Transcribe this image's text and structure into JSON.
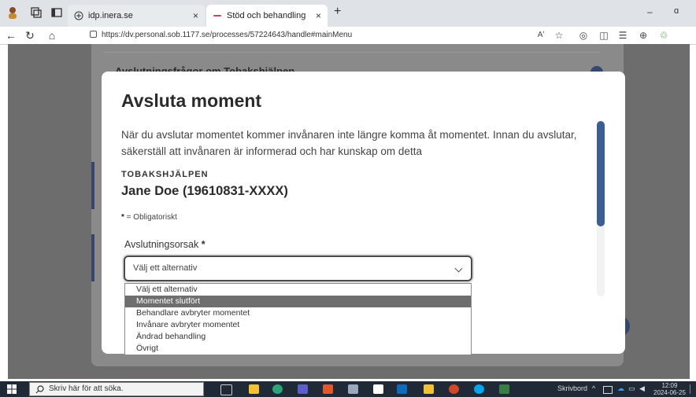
{
  "browser": {
    "tabs": [
      {
        "label": "idp.inera.se",
        "close": "×"
      },
      {
        "label": "Stöd och behandling",
        "close": "×"
      }
    ],
    "new_tab": "+",
    "window_minimize": "–",
    "window_restore": "ɑ",
    "url": "https://dv.personal.sob.1177.se/processes/57224643/handle#mainMenu",
    "reader_label": "Aʹ"
  },
  "page": {
    "background_heading": "Avslutningsfrågor om Tobakshjälpen"
  },
  "modal": {
    "title": "Avsluta moment",
    "description": "När du avslutar momentet kommer invånaren inte längre komma åt momentet. Innan du avslutar, säkerställ att invånaren är informerad och har kunskap om detta",
    "program": "TOBAKSHJÄLPEN",
    "patient": "Jane Doe (19610831-XXXX)",
    "required_star": "*",
    "required_note": " = Obligatoriskt",
    "field_label": "Avslutningsorsak",
    "field_star": "*",
    "select_value": "Välj ett alternativ"
  },
  "dropdown": {
    "options": [
      "Välj ett alternativ",
      "Momentet slutfört",
      "Behandlare avbryter momentet",
      "Invånare avbryter momentet",
      "Ändrad behandling",
      "Övrigt"
    ],
    "highlighted_index": 1
  },
  "taskbar": {
    "search_placeholder": "Skriv här för att söka.",
    "desk_label": "Skrivbord",
    "time": "12:09",
    "date": "2024-06-25"
  },
  "colors": {
    "accent": "#3c5f93",
    "overlay": "#6d6d6d",
    "highlight": "#6e6e6e"
  }
}
